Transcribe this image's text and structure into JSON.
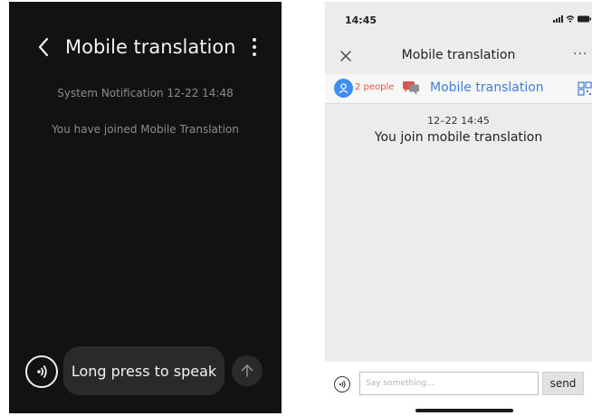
{
  "dark_screen": {
    "title": "Mobile translation",
    "system_notification": "System Notification 12-22 14:48",
    "joined_message": "You have joined Mobile Translation",
    "speak_button_label": "Long press to speak",
    "icons": {
      "back": "chevron-left-icon",
      "menu": "vertical-ellipsis-icon",
      "voice": "voice-waves-icon",
      "send": "arrow-up-icon"
    },
    "colors": {
      "background": "#121214",
      "text": "#f3f3f3",
      "muted": "#8b8b8f"
    }
  },
  "light_screen": {
    "status_time": "14:45",
    "nav_title": "Mobile translation",
    "more_label": "···",
    "participants_label": "2 people",
    "chat_title": "Mobile translation",
    "timestamp": "12–22 14:45",
    "join_message": "You join mobile translation",
    "input_placeholder": "Say something...",
    "send_label": "send",
    "icons": {
      "close": "close-icon",
      "person": "person-icon",
      "chat": "chat-bubbles-icon",
      "qr": "qr-code-icon",
      "voice": "voice-waves-icon",
      "signal": "signal-icon",
      "wifi": "wifi-icon",
      "battery": "battery-icon"
    },
    "colors": {
      "accent": "#3f7fd8",
      "people": "#e05a3a",
      "background": "#ececec"
    }
  }
}
